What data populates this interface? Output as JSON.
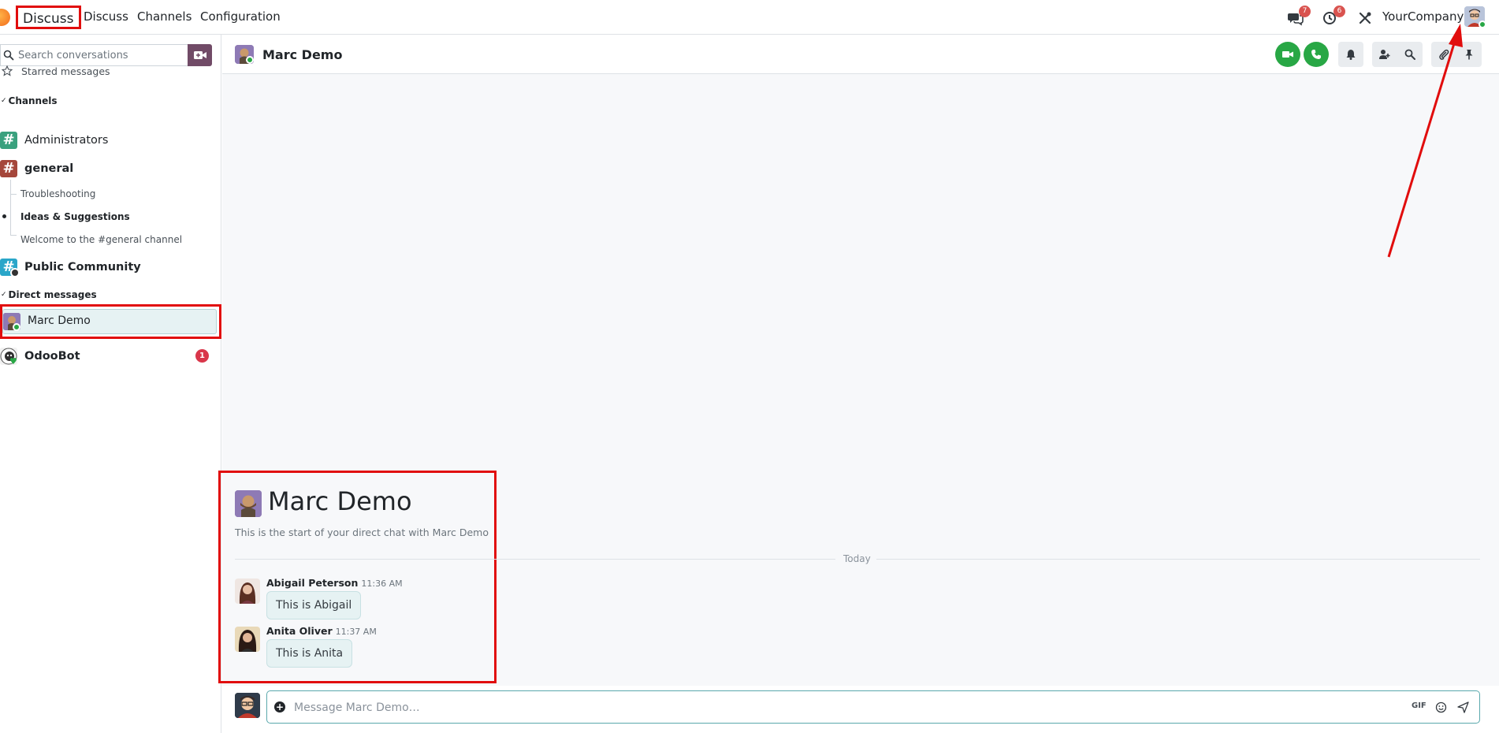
{
  "navbar": {
    "app_name": "Discuss",
    "menu": [
      "Discuss",
      "Channels",
      "Configuration"
    ],
    "messages_badge": "7",
    "activities_badge": "6",
    "company": "YourCompany"
  },
  "sidebar": {
    "search_placeholder": "Search conversations",
    "starred": "Starred messages",
    "channels_header": "Channels",
    "channels": [
      {
        "name": "Administrators",
        "color": "#3aa17e"
      },
      {
        "name": "general",
        "color": "#a5473b"
      },
      {
        "name": "Public Community",
        "color": "#2aa6c9"
      }
    ],
    "sub_threads": [
      "Troubleshooting",
      "Ideas & Suggestions",
      "Welcome to the #general channel"
    ],
    "dm_header": "Direct messages",
    "dms": [
      {
        "name": "Marc Demo"
      },
      {
        "name": "OdooBot",
        "unread": "1"
      }
    ]
  },
  "thread": {
    "title": "Marc Demo",
    "intro_title": "Marc Demo",
    "intro_sub": "This is the start of your direct chat with Marc Demo",
    "divider": "Today",
    "messages": [
      {
        "author": "Abigail Peterson",
        "time": "11:36 AM",
        "text": "This is Abigail"
      },
      {
        "author": "Anita Oliver",
        "time": "11:37 AM",
        "text": "This is Anita"
      }
    ]
  },
  "composer": {
    "placeholder": "Message Marc Demo…",
    "gif_label": "GIF"
  },
  "colors": {
    "accent": "#714b67",
    "highlight": "#e10d0d",
    "green": "#28a745"
  }
}
